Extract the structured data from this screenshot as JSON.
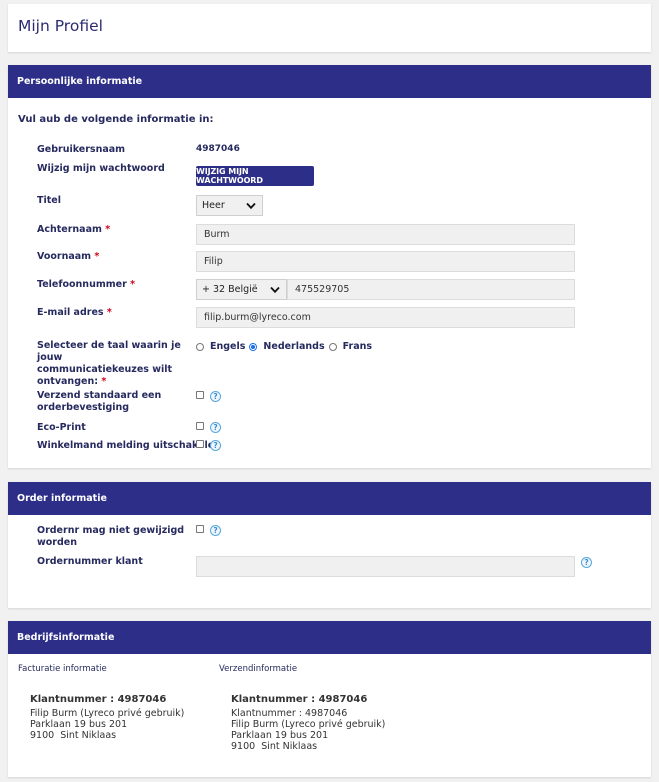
{
  "page_title": "Mijn Profiel",
  "personal": {
    "header": "Persoonlijke informatie",
    "intro": "Vul aub de volgende informatie in:",
    "username_label": "Gebruikersnaam",
    "username_value": "4987046",
    "password_label": "Wijzig mijn wachtwoord",
    "password_button": "WIJZIG MIJN WACHTWOORD",
    "title_label": "Titel",
    "title_value": "Heer",
    "lastname_label": "Achternaam",
    "lastname_value": "Burm",
    "firstname_label": "Voornaam",
    "firstname_value": "Filip",
    "phone_label": "Telefoonnummer",
    "phone_country": "+ 32 België",
    "phone_value": "475529705",
    "email_label": "E-mail adres",
    "email_value": "filip.burm@lyreco.com",
    "language_label_1": "Selecteer de taal waarin je jouw",
    "language_label_2": "communicatiekeuzes wilt",
    "language_label_3": "ontvangen:",
    "languages": [
      "Engels",
      "Nederlands",
      "Frans"
    ],
    "language_selected": "Nederlands",
    "order_confirm_label_1": "Verzend standaard een",
    "order_confirm_label_2": "orderbevestiging",
    "eco_label": "Eco-Print",
    "cart_label": "Winkelmand melding uitschakelen",
    "required_mark": "*",
    "help_mark": "?"
  },
  "order": {
    "header": "Order informatie",
    "ordernr_label_1": "Ordernr mag niet gewijzigd",
    "ordernr_label_2": "worden",
    "client_ordernr_label": "Ordernummer klant",
    "client_ordernr_value": ""
  },
  "company": {
    "header": "Bedrijfsinformatie",
    "billing_title": "Facturatie informatie",
    "shipping_title": "Verzendinformatie",
    "billing": {
      "heading": "Klantnummer : 4987046",
      "line1": "Filip Burm (Lyreco privé gebruik)",
      "line2": "Parklaan 19 bus 201",
      "line3": "9100  Sint Niklaas"
    },
    "shipping": {
      "heading": "Klantnummer : 4987046",
      "line0": "Klantnummer : 4987046",
      "line1": "Filip Burm (Lyreco privé gebruik)",
      "line2": "Parklaan 19 bus 201",
      "line3": "9100  Sint Niklaas"
    }
  },
  "colors": {
    "header_bar": "#2d2e87",
    "required": "#d0021b",
    "help": "#3a8ccf"
  }
}
